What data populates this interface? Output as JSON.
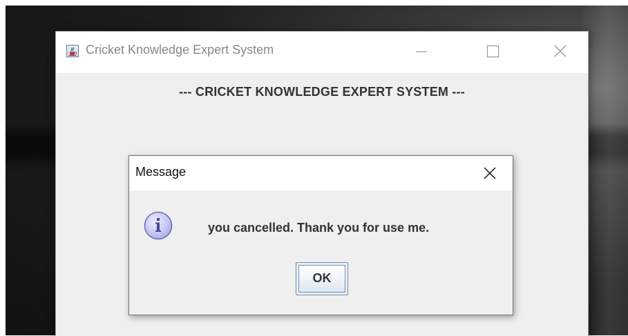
{
  "main_window": {
    "title": "Cricket Knowledge Expert System",
    "controls": {
      "minimize_icon": "minimize-icon",
      "maximize_icon": "maximize-icon",
      "close_icon": "close-icon"
    },
    "heading": "--- CRICKET KNOWLEDGE EXPERT SYSTEM ---",
    "app_icon": "java-coffee-cup-icon"
  },
  "dialog": {
    "title": "Message",
    "close_icon": "close-icon",
    "icon": "information-icon",
    "message": "you cancelled. Thank you for use me.",
    "ok_label": "OK"
  },
  "colors": {
    "window_bg": "#efefef",
    "titlebar_bg": "#ffffff",
    "title_text": "#888888",
    "info_icon_fill": "#c9c9f2",
    "info_icon_border": "#6f6fb8"
  }
}
